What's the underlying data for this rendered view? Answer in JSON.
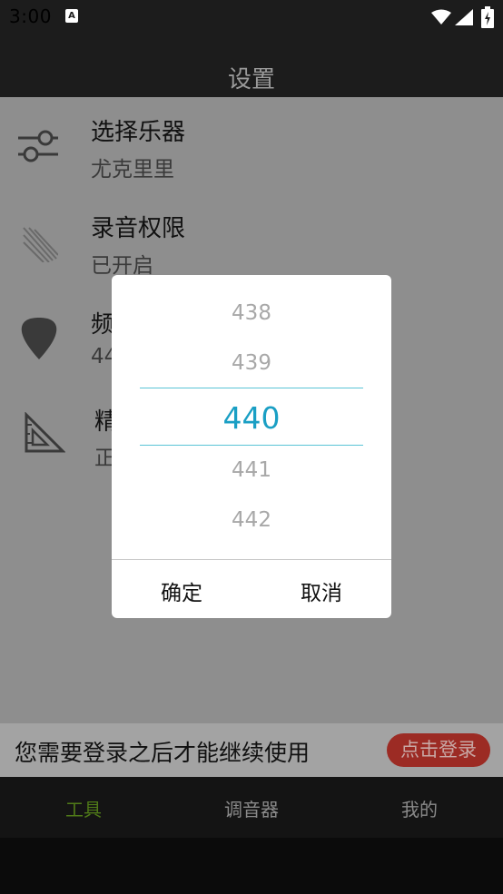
{
  "status_bar": {
    "time": "3:00",
    "notification_glyph": "A"
  },
  "header": {
    "title": "设置"
  },
  "settings": {
    "items": [
      {
        "title": "选择乐器",
        "subtitle": "尤克里里",
        "icon": "sliders-icon"
      },
      {
        "title": "录音权限",
        "subtitle": "已开启",
        "icon": "strings-icon"
      },
      {
        "title": "频",
        "subtitle": "44",
        "icon": "guitar-pick-icon"
      },
      {
        "title": "精",
        "subtitle": "正",
        "icon": "set-square-icon"
      }
    ]
  },
  "dialog": {
    "picker": {
      "values": [
        "438",
        "439",
        "440",
        "441",
        "442"
      ],
      "selected": "440"
    },
    "confirm_label": "确定",
    "cancel_label": "取消"
  },
  "login_banner": {
    "text": "您需要登录之后才能继续使用",
    "button_label": "点击登录"
  },
  "bottom_nav": {
    "items": [
      {
        "label": "工具",
        "active": true
      },
      {
        "label": "调音器",
        "active": false
      },
      {
        "label": "我的",
        "active": false
      }
    ]
  },
  "colors": {
    "accent": "#1a9fc4",
    "nav_active": "#4f7a18",
    "login_button": "#9c2b24"
  }
}
